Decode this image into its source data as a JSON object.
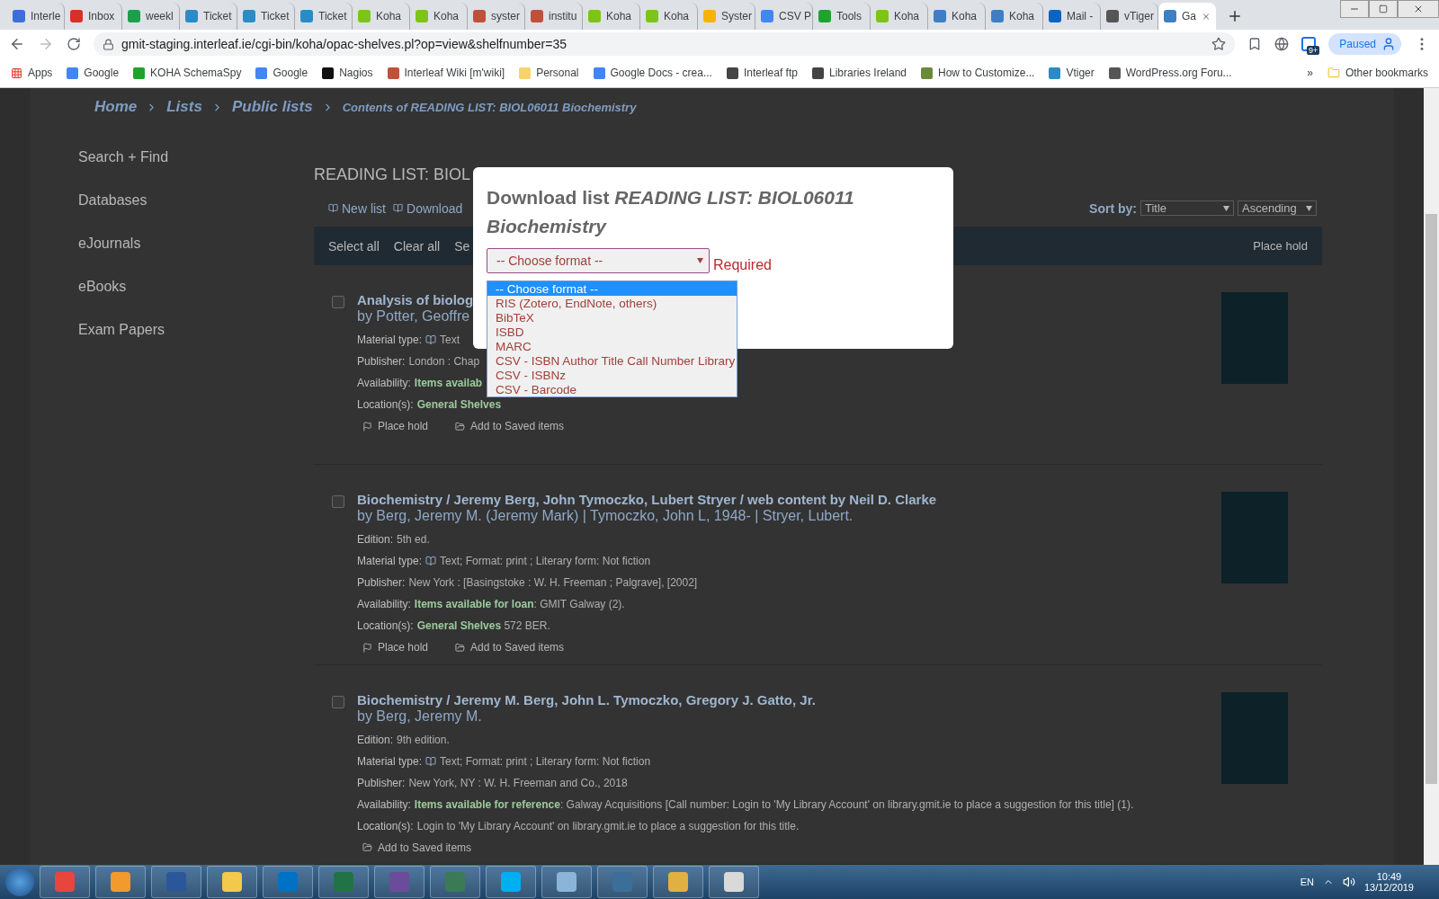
{
  "browser": {
    "tabs": [
      {
        "label": "Interle",
        "color": "#3b6fd8",
        "selected": false
      },
      {
        "label": "Inbox",
        "color": "#d93025",
        "selected": false
      },
      {
        "label": "weekl",
        "color": "#1e9e4a",
        "selected": false
      },
      {
        "label": "Ticket",
        "color": "#2a8bc6",
        "selected": false
      },
      {
        "label": "Ticket",
        "color": "#2a8bc6",
        "selected": false
      },
      {
        "label": "Ticket",
        "color": "#2a8bc6",
        "selected": false
      },
      {
        "label": "Koha",
        "color": "#7cc518",
        "selected": false
      },
      {
        "label": "Koha",
        "color": "#7cc518",
        "selected": false
      },
      {
        "label": "syster",
        "color": "#c0503a",
        "selected": false
      },
      {
        "label": "institu",
        "color": "#c0503a",
        "selected": false
      },
      {
        "label": "Koha",
        "color": "#7cc518",
        "selected": false
      },
      {
        "label": "Koha",
        "color": "#7cc518",
        "selected": false
      },
      {
        "label": "Syster",
        "color": "#f4b400",
        "selected": false
      },
      {
        "label": "CSV P",
        "color": "#4285f4",
        "selected": false
      },
      {
        "label": "Tools",
        "color": "#1ea32c",
        "selected": false
      },
      {
        "label": "Koha",
        "color": "#7cc518",
        "selected": false
      },
      {
        "label": "Koha",
        "color": "#3c7fc4",
        "selected": false
      },
      {
        "label": "Koha",
        "color": "#3c7fc4",
        "selected": false
      },
      {
        "label": "Mail -",
        "color": "#0a64c2",
        "selected": false
      },
      {
        "label": "vTiger",
        "color": "#555555",
        "selected": false
      },
      {
        "label": "Ga",
        "color": "#3c7fc4",
        "selected": true
      }
    ],
    "url": "gmit-staging.interleaf.ie/cgi-bin/koha/opac-shelves.pl?op=view&shelfnumber=35",
    "badge": "9+",
    "profile": "Paused",
    "bookmarks": [
      "Apps",
      "Google",
      "KOHA SchemaSpy",
      "Google",
      "Nagios",
      "Interleaf Wiki [m'wiki]",
      "Personal",
      "Google Docs - crea...",
      "Interleaf ftp",
      "Libraries Ireland",
      "How to Customize...",
      "Vtiger",
      "WordPress.org Foru..."
    ],
    "more": "»",
    "other_bookmarks": "Other bookmarks"
  },
  "breadcrumb": [
    "Home",
    "Lists",
    "Public lists"
  ],
  "breadcrumb_current": "Contents of *READING LIST: BIOL06011 Biochemistry*",
  "sidebar": {
    "items": [
      "Search + Find",
      "Databases",
      "eJournals",
      "eBooks",
      "Exam Papers"
    ]
  },
  "list": {
    "heading": "READING LIST: BIOL",
    "toolbar": [
      "New list",
      "Download"
    ],
    "sort_label": "Sort by:",
    "sort_field": "Title",
    "sort_order": "Ascending",
    "bar": [
      "Select all",
      "Clear all",
      "Se"
    ],
    "bar_right": "Place hold",
    "records": [
      {
        "checked": false,
        "title": "Analysis of biolog",
        "by": "by Potter, Geoffre",
        "fields": [
          {
            "kind": "material",
            "label": "Material type:",
            "value": "Text"
          },
          {
            "kind": "text",
            "label": "Publisher:",
            "value": "London : Chap"
          },
          {
            "kind": "text",
            "label": "Availability:",
            "value": "**Items availab**"
          },
          {
            "kind": "text",
            "label": "Location(s):",
            "value": "**General Shelves**"
          }
        ],
        "actions": [
          {
            "kind": "hold",
            "label": "Place hold"
          },
          {
            "kind": "save",
            "label": "Add to Saved items"
          }
        ]
      },
      {
        "checked": false,
        "title": "Biochemistry / Jeremy Berg, John Tymoczko, Lubert Stryer / web content by Neil D. Clarke",
        "by": "by Berg, Jeremy M. (Jeremy Mark) | Tymoczko, John L, 1948- | Stryer, Lubert.",
        "fields": [
          {
            "kind": "text",
            "label": "Edition:",
            "value": "5th ed."
          },
          {
            "kind": "material",
            "label": "Material type:",
            "value": "Text; Format: print ; Literary form: Not fiction"
          },
          {
            "kind": "text",
            "label": "Publisher:",
            "value": "New York : [Basingstoke : W. H. Freeman ; Palgrave], [2002]"
          },
          {
            "kind": "text",
            "label": "Availability:",
            "value": "**Items available for loan**: GMIT Galway (2)."
          },
          {
            "kind": "text",
            "label": "Location(s):",
            "value": "**General Shelves** 572 BER."
          }
        ],
        "actions": [
          {
            "kind": "hold",
            "label": "Place hold"
          },
          {
            "kind": "save",
            "label": "Add to Saved items"
          }
        ]
      },
      {
        "checked": false,
        "title": "Biochemistry / Jeremy M. Berg, John L. Tymoczko, Gregory J. Gatto, Jr.",
        "by": "by Berg, Jeremy M.",
        "fields": [
          {
            "kind": "text",
            "label": "Edition:",
            "value": "9th edition."
          },
          {
            "kind": "material",
            "label": "Material type:",
            "value": "Text; Format: print ; Literary form: Not fiction"
          },
          {
            "kind": "text",
            "label": "Publisher:",
            "value": "New York, NY : W. H. Freeman and Co., 2018"
          },
          {
            "kind": "text",
            "label": "Availability:",
            "value": "**Items available for reference**: Galway Acquisitions [Call number: Login to 'My Library Account' on library.gmit.ie to place a suggestion for this title] (1)."
          },
          {
            "kind": "text",
            "label": "Location(s):",
            "value": "Login to 'My Library Account' on library.gmit.ie to place a suggestion for this title."
          }
        ],
        "actions": [
          {
            "kind": "save",
            "label": "Add to Saved items"
          }
        ]
      }
    ]
  },
  "modal": {
    "title": "Download list *READING LIST: BIOL06011 Biochemistry*",
    "select": "-- Choose format --",
    "error": "Required",
    "options": [
      {
        "label": "-- Choose format --",
        "selected": true
      },
      {
        "label": "RIS (Zotero, EndNote, others)",
        "selected": false
      },
      {
        "label": "BibTeX",
        "selected": false
      },
      {
        "label": "ISBD",
        "selected": false
      },
      {
        "label": "MARC",
        "selected": false
      },
      {
        "label": "CSV - ISBN Author Title Call Number Library",
        "selected": false
      },
      {
        "label": "CSV - ISBNz",
        "selected": false
      },
      {
        "label": "CSV - Barcode",
        "selected": false
      }
    ]
  },
  "taskbar": {
    "lang": "EN",
    "time": "10:49",
    "date": "13/12/2019"
  }
}
